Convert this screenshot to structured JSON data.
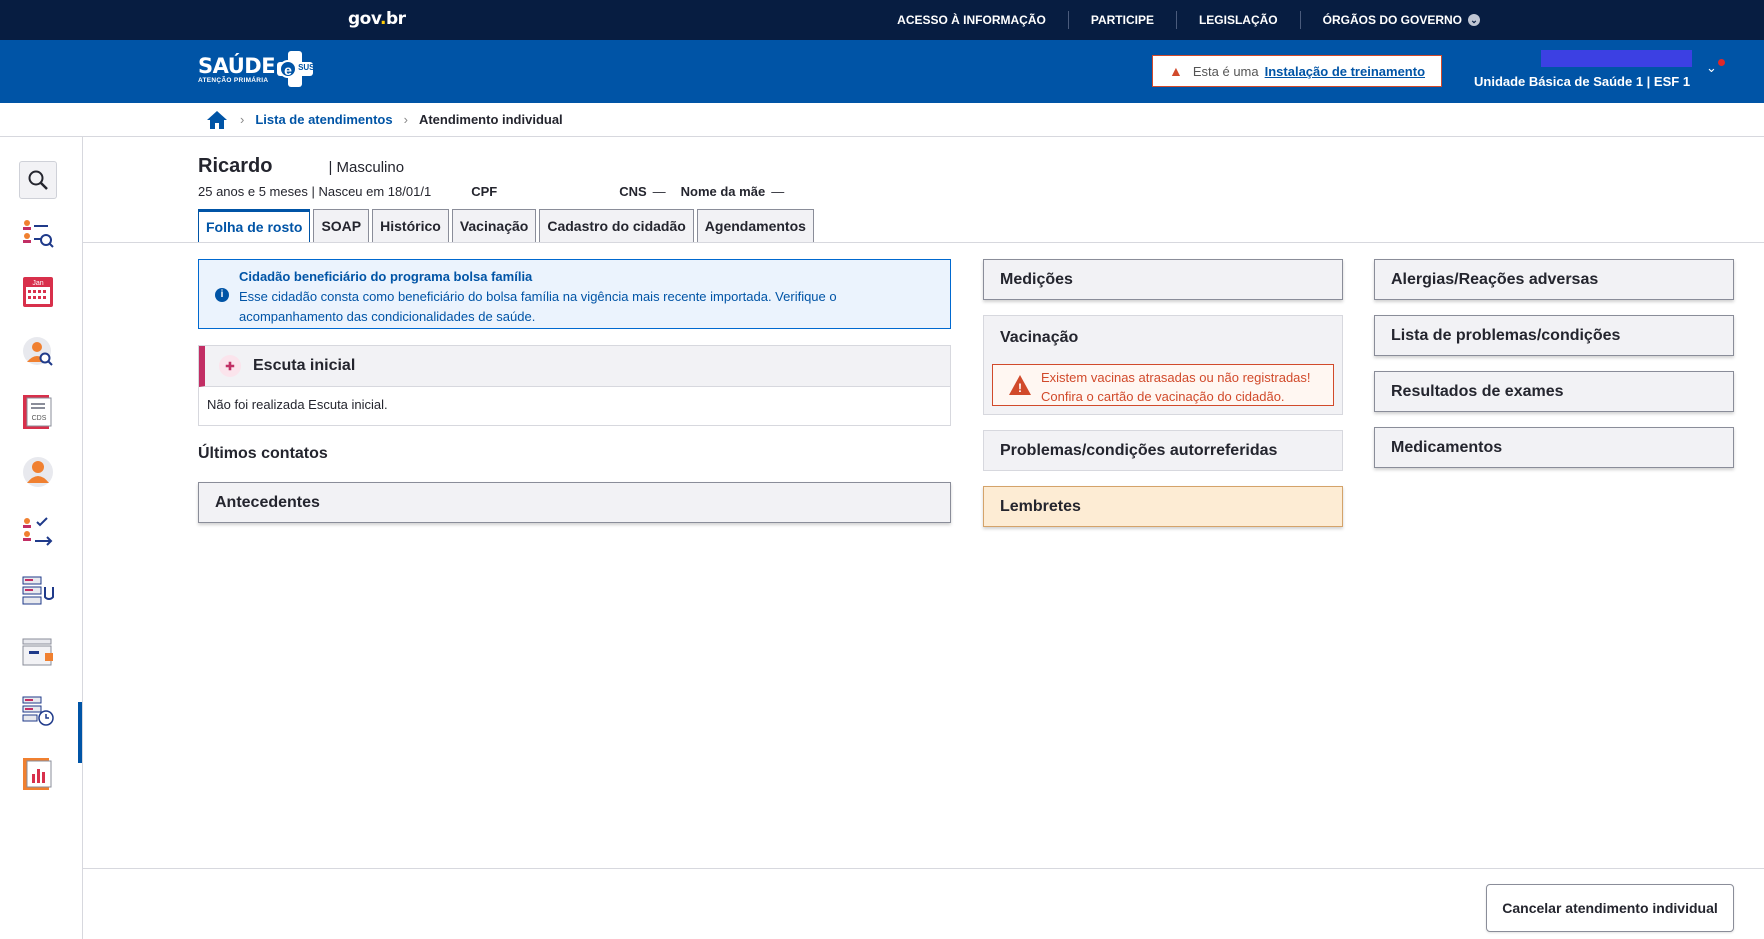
{
  "gov": {
    "logo": "gov.br",
    "logo_main": "gov",
    "logo_dot": ".",
    "logo_br": "br",
    "nav": [
      "ACESSO À INFORMAÇÃO",
      "PARTICIPE",
      "LEGISLAÇÃO",
      "ÓRGÃOS DO GOVERNO"
    ]
  },
  "header": {
    "brand_main": "SAÚDE",
    "brand_sub": "ATENÇÃO PRIMÁRIA",
    "brand_e": "e",
    "brand_sus": "SUS",
    "training_prefix": "Esta é uma",
    "training_link": "Instalação de treinamento",
    "unit": "Unidade Básica de Saúde 1 | ESF 1",
    "colors": {
      "govbar": "#071d41",
      "header": "#0054a6",
      "accent": "#0054a6",
      "warning": "#d14a2b"
    }
  },
  "breadcrumb": {
    "items": [
      "Lista de atendimentos",
      "Atendimento individual"
    ]
  },
  "sidebar": {
    "icons": [
      "search-icon",
      "patient-list-search-icon",
      "calendar-icon",
      "person-search-icon",
      "cds-document-icon",
      "citizen-icon",
      "checklist-transfer-icon",
      "attendance-stethoscope-icon",
      "records-icon",
      "schedule-list-icon",
      "reports-chart-icon"
    ],
    "calendar_label": "Jan",
    "cds_label": "CDS"
  },
  "patient": {
    "name": "Ricardo",
    "sex": "| Masculino",
    "age_birth": "25 anos e 5 meses | Nasceu em 18/01/1",
    "cpf_label": "CPF",
    "cns_label": "CNS",
    "cns_value": "—",
    "mother_label": "Nome da mãe",
    "mother_value": "—"
  },
  "tabs": [
    "Folha de rosto",
    "SOAP",
    "Histórico",
    "Vacinação",
    "Cadastro do cidadão",
    "Agendamentos"
  ],
  "bolsa": {
    "title": "Cidadão beneficiário do programa bolsa família",
    "text1": "Esse cidadão consta como beneficiário do bolsa família na vigência mais recente importada. Verifique o",
    "text2": "acompanhamento das condicionalidades de saúde."
  },
  "escuta": {
    "title": "Escuta inicial",
    "body": "Não foi realizada Escuta inicial."
  },
  "ultimos_contatos": "Últimos contatos",
  "antecedentes": "Antecedentes",
  "middle": {
    "medicoes": "Medições",
    "vacinacao": "Vacinação",
    "vac_warn1": "Existem vacinas atrasadas ou não registradas!",
    "vac_warn2": "Confira o cartão de vacinação do cidadão.",
    "problemas_auto": "Problemas/condições autorreferidas",
    "lembretes": "Lembretes"
  },
  "right": {
    "alergias": "Alergias/Reações adversas",
    "lista_problemas": "Lista de problemas/condições",
    "resultados": "Resultados de exames",
    "medicamentos": "Medicamentos"
  },
  "footer": {
    "cancel": "Cancelar atendimento individual"
  }
}
